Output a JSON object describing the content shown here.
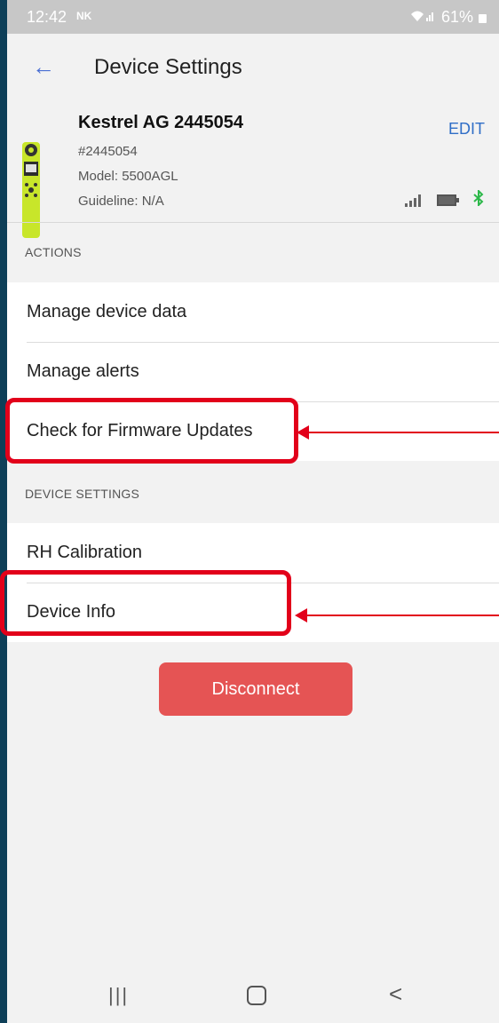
{
  "status_bar": {
    "time": "12:42",
    "logo": "NK",
    "battery": "61%"
  },
  "header": {
    "title": "Device Settings",
    "device_name": "Kestrel AG 2445054",
    "edit_label": "EDIT",
    "device_id": "#2445054",
    "model": "Model: 5500AGL",
    "guideline": "Guideline: N/A"
  },
  "actions": {
    "section_label": "ACTIONS",
    "items": [
      "Manage device data",
      "Manage alerts",
      "Check for Firmware Updates"
    ]
  },
  "device_settings": {
    "section_label": "DEVICE SETTINGS",
    "items": [
      "RH Calibration",
      "Device Info"
    ]
  },
  "disconnect_label": "Disconnect",
  "nav": {
    "recent_icon": "|||",
    "back_icon": "<"
  },
  "colors": {
    "accent": "#4a6fd3",
    "disconnect": "#e55454",
    "highlight": "#e2001a",
    "bluetooth": "#2db84a"
  }
}
